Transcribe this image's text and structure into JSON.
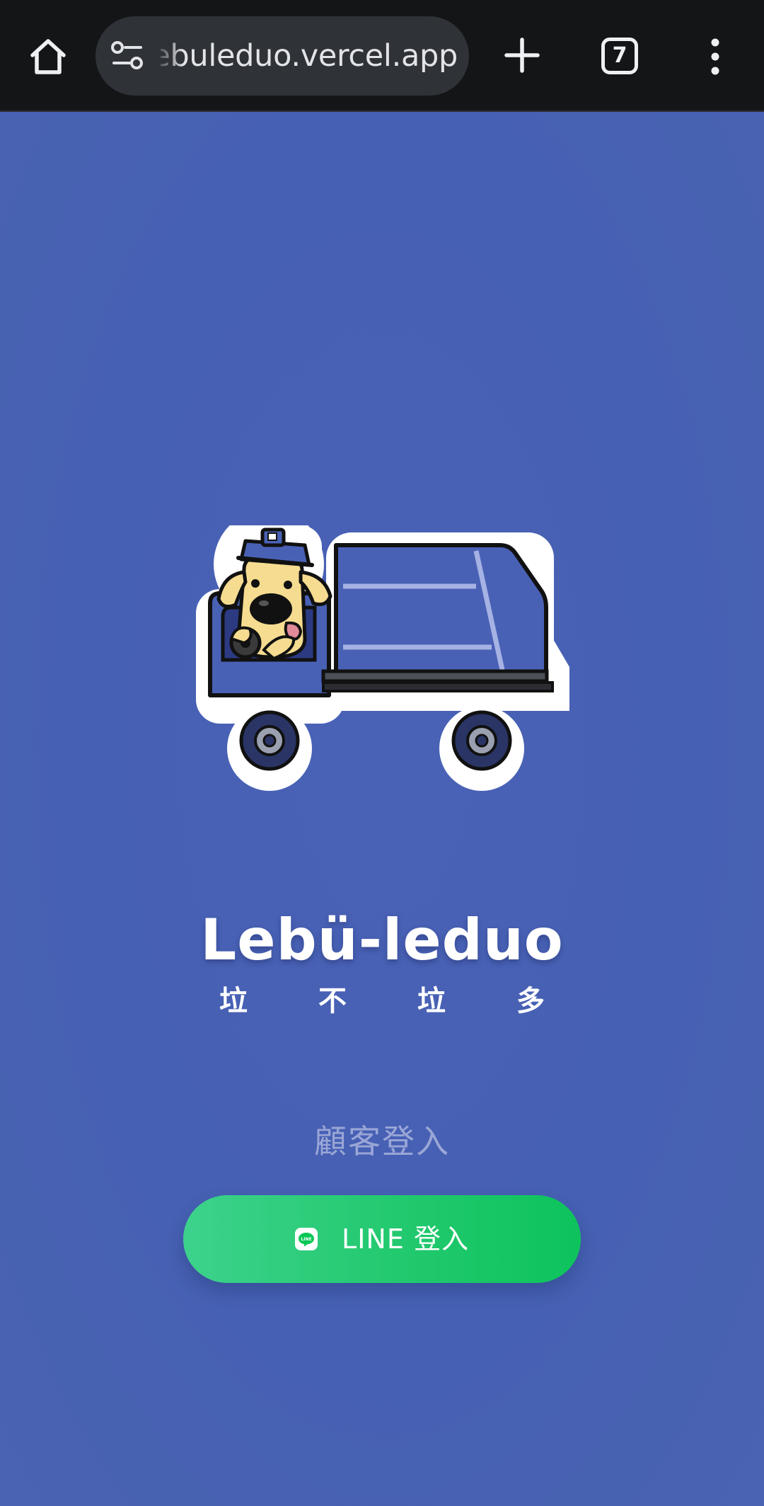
{
  "browser": {
    "url": "lebuleduo.vercel.app",
    "tab_count": "7",
    "icons": [
      "home-icon",
      "site-settings-icon",
      "new-tab-icon",
      "tab-switcher-icon",
      "more-menu-icon"
    ]
  },
  "brand": {
    "name": "Lebü-leduo",
    "subtitle_chars": [
      "垃",
      "不",
      "垃",
      "多"
    ],
    "logo_text": "LINE"
  },
  "login": {
    "label": "顧客登入",
    "line_button_label": "LINE 登入"
  },
  "colors": {
    "background": "#4760b4",
    "chrome": "#141517",
    "url_pill": "#2f3237",
    "line_green": "#06c755",
    "login_label": "#9aa6d6"
  }
}
